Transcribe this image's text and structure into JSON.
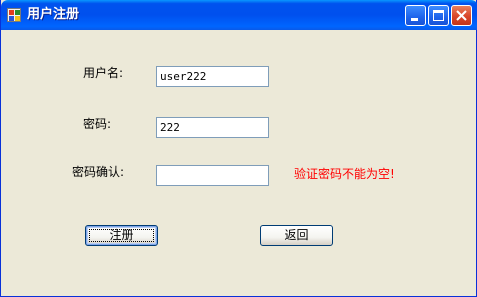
{
  "window": {
    "title": "用户注册"
  },
  "form": {
    "username_label": "用户名:",
    "username_value": "user222",
    "password_label": "密码:",
    "password_value": "222",
    "confirm_label": "密码确认:",
    "confirm_value": "",
    "error_message": "验证密码不能为空!"
  },
  "buttons": {
    "register_label": "注册",
    "back_label": "返回"
  },
  "colors": {
    "error": "#ff0000",
    "title_bar": "#0053ee",
    "window_bg": "#ece9d8"
  }
}
